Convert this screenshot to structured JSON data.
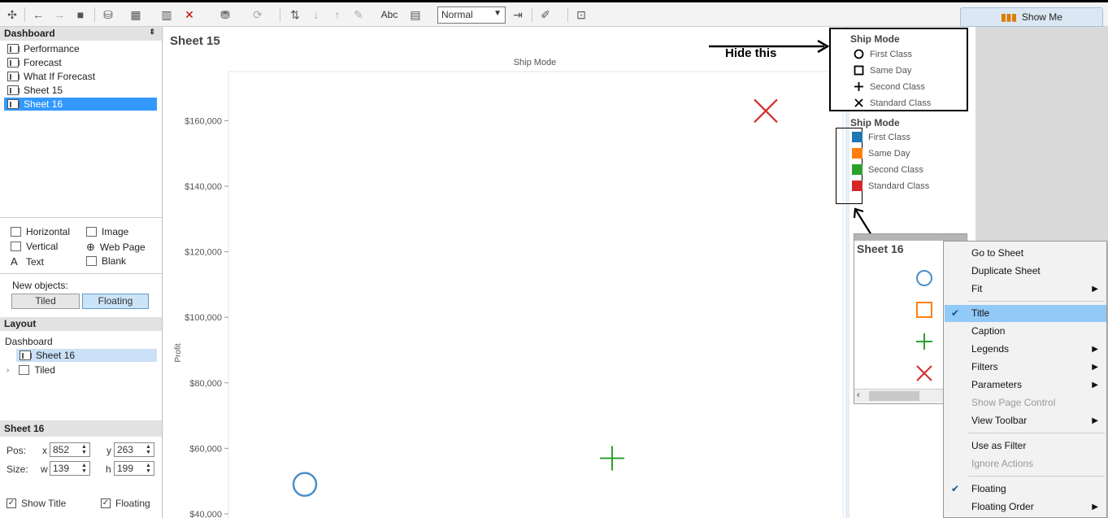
{
  "toolbar": {
    "fit_value": "Normal",
    "abc_label": "Abc",
    "show_me_label": "Show Me"
  },
  "left_panel": {
    "dashboard_header": "Dashboard",
    "sheets": [
      {
        "label": "Performance"
      },
      {
        "label": "Forecast"
      },
      {
        "label": "What If Forecast"
      },
      {
        "label": "Sheet 15"
      },
      {
        "label": "Sheet 16"
      }
    ],
    "objects": {
      "horizontal": "Horizontal",
      "image": "Image",
      "vertical": "Vertical",
      "web_page": "Web Page",
      "text": "Text",
      "blank": "Blank"
    },
    "new_objects_label": "New objects:",
    "tiled_label": "Tiled",
    "floating_label": "Floating",
    "layout_header": "Layout",
    "layout_tree": {
      "root": "Dashboard",
      "child_sheet": "Sheet 16",
      "child_tiled": "Tiled"
    },
    "sheet_panel": {
      "header": "Sheet 16",
      "pos_label": "Pos:",
      "size_label": "Size:",
      "x_label": "x",
      "x_value": "852",
      "y_label": "y",
      "y_value": "263",
      "w_label": "w",
      "w_value": "139",
      "h_label": "h",
      "h_value": "199",
      "show_title_label": "Show Title",
      "floating_label": "Floating"
    }
  },
  "canvas": {
    "sheet_title": "Sheet 15",
    "annotation": "Hide this",
    "shape_legend": {
      "title": "Ship Mode",
      "items": [
        {
          "label": "First Class",
          "shape": "circle"
        },
        {
          "label": "Same Day",
          "shape": "square"
        },
        {
          "label": "Second Class",
          "shape": "plus"
        },
        {
          "label": "Standard Class",
          "shape": "cross"
        }
      ]
    },
    "color_legend": {
      "title": "Ship Mode",
      "items": [
        {
          "label": "First Class",
          "color": "#1f77b4"
        },
        {
          "label": "Same Day",
          "color": "#ff7f0e"
        },
        {
          "label": "Second Class",
          "color": "#2ca02c"
        },
        {
          "label": "Standard Class",
          "color": "#d62728"
        }
      ]
    },
    "float_sheet_title": "Sheet 16"
  },
  "chart_data": {
    "type": "scatter",
    "title": "",
    "xlabel": "Ship Mode",
    "ylabel": "Profit",
    "ylim": [
      38000,
      175000
    ],
    "y_ticks": [
      "$40,000",
      "$60,000",
      "$80,000",
      "$100,000",
      "$120,000",
      "$140,000",
      "$160,000"
    ],
    "y_tick_values": [
      40000,
      60000,
      80000,
      100000,
      120000,
      140000,
      160000
    ],
    "points": [
      {
        "category": "First Class",
        "x_index": 0,
        "y": 49000,
        "shape": "circle",
        "color": "#4a8fc7"
      },
      {
        "category": "Second Class",
        "x_index": 1,
        "y": 57000,
        "shape": "plus",
        "color": "#2ca02c"
      },
      {
        "category": "Standard Class",
        "x_index": 2,
        "y": 163000,
        "shape": "cross",
        "color": "#d62728"
      }
    ]
  },
  "context_menu": {
    "items": [
      {
        "label": "Go to Sheet"
      },
      {
        "label": "Duplicate Sheet"
      },
      {
        "label": "Fit",
        "submenu": true
      },
      {
        "label": "Title",
        "checked": true,
        "highlighted": true
      },
      {
        "label": "Caption"
      },
      {
        "label": "Legends",
        "submenu": true
      },
      {
        "label": "Filters",
        "submenu": true
      },
      {
        "label": "Parameters",
        "submenu": true
      },
      {
        "label": "Show Page Control",
        "disabled": true
      },
      {
        "label": "View Toolbar",
        "submenu": true
      },
      {
        "label": "Use as Filter"
      },
      {
        "label": "Ignore Actions",
        "disabled": true
      },
      {
        "label": "Floating",
        "checked": true
      },
      {
        "label": "Floating Order",
        "submenu": true
      }
    ]
  }
}
